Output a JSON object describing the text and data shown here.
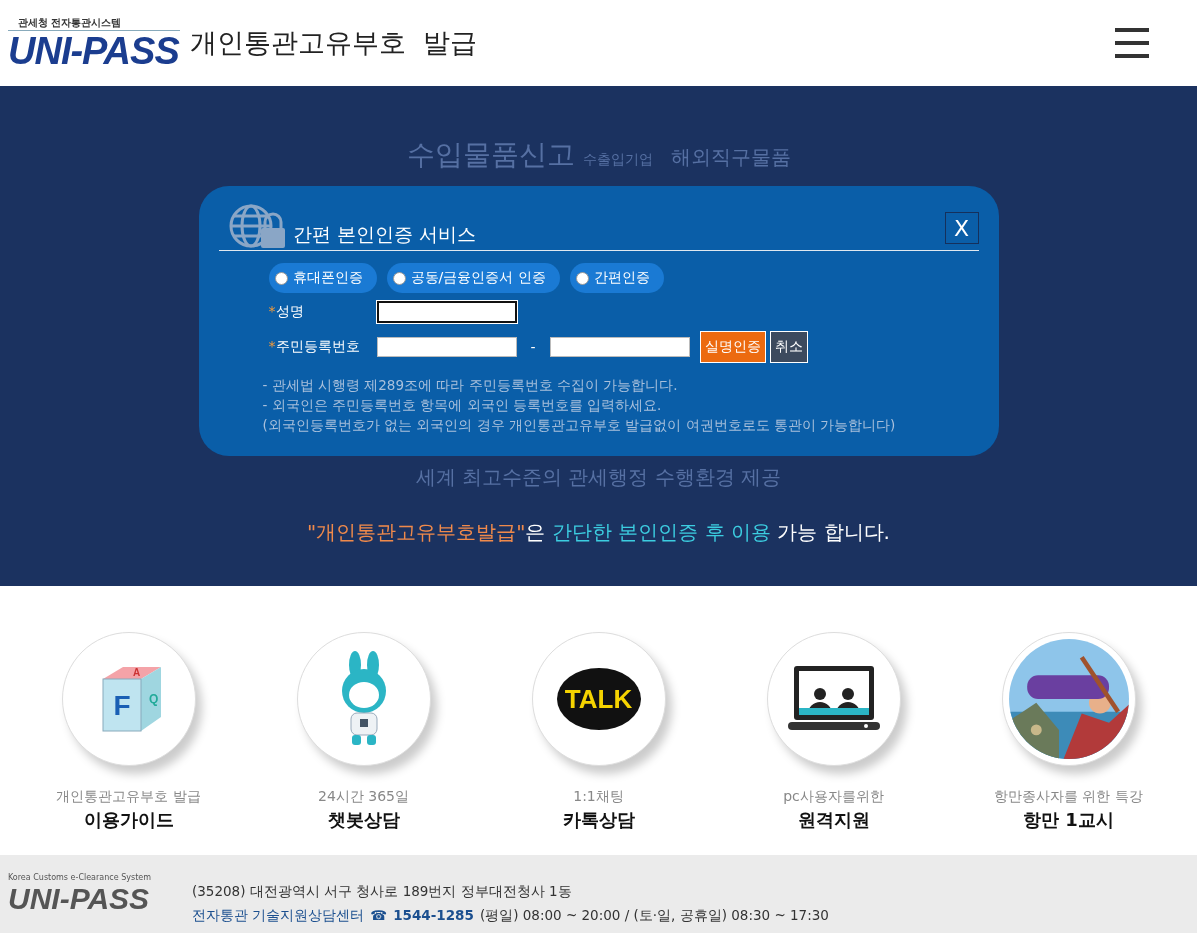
{
  "header": {
    "logo_caption": "관세청 전자통관시스템",
    "logo_text": "UNI-PASS",
    "title": "개인통관고유부호  발급"
  },
  "background_words": {
    "top": [
      "수입물품신고",
      "수출입기업",
      "해외직구물품"
    ],
    "bottom": "세계 최고수준의 관세행정 수행환경 제공"
  },
  "dialog": {
    "title": "간편 본인인증 서비스",
    "close": "X",
    "methods": [
      {
        "label": "휴대폰인증",
        "selected": false
      },
      {
        "label": "공동/금융인증서 인증",
        "selected": false
      },
      {
        "label": "간편인증",
        "selected": false
      }
    ],
    "required_mark": "*",
    "name_label": "성명",
    "rrn_label": "주민등록번호",
    "rrn_separator": "-",
    "verify_button": "실명인증",
    "cancel_button": "취소",
    "notes": [
      "- 관세법 시행령 제289조에 따라 주민등록번호 수집이 가능합니다.",
      "- 외국인은 주민등록번호 항목에 외국인 등록번호를 입력하세요.",
      "(외국인등록번호가 없는 외국인의 경우 개인통관고유부호 발급없이 여권번호로도 통관이 가능합니다)"
    ]
  },
  "notice": [
    {
      "text": "\"개인통관고유부호발급\"",
      "kind": "orange"
    },
    {
      "text": "은 ",
      "kind": "plain"
    },
    {
      "text": "간단한 본인인증 후 이용",
      "kind": "cyan"
    },
    {
      "text": " 가능 합니다.",
      "kind": "plain"
    }
  ],
  "services": [
    {
      "kind": "faq",
      "icon_letters": [
        "F",
        "A",
        "Q"
      ],
      "subtitle": "개인통관고유부호 발급",
      "title": "이용가이드"
    },
    {
      "kind": "bot",
      "subtitle": "24시간 365일",
      "title": "챗봇상담"
    },
    {
      "kind": "talk",
      "icon_text": "TALK",
      "subtitle": "1:1채팅",
      "title": "카톡상담"
    },
    {
      "kind": "remote",
      "subtitle": "pc사용자를위한",
      "title": "원격지원"
    },
    {
      "kind": "picture",
      "subtitle": "항만종사자를 위한 특강",
      "title": "항만 1교시"
    }
  ],
  "footer": {
    "logo_caption": "Korea Customs e-Clearance System",
    "logo_text": "UNI-PASS",
    "address": "(35208) 대전광역시 서구 청사로 189번지 정부대전청사 1동",
    "center": "전자통관 기술지원상담센터",
    "phone_icon": "☎",
    "phone": "1544-1285",
    "hours": "(평일) 08:00 ~ 20:00 / (토·일, 공휴일) 08:30 ~ 17:30"
  }
}
